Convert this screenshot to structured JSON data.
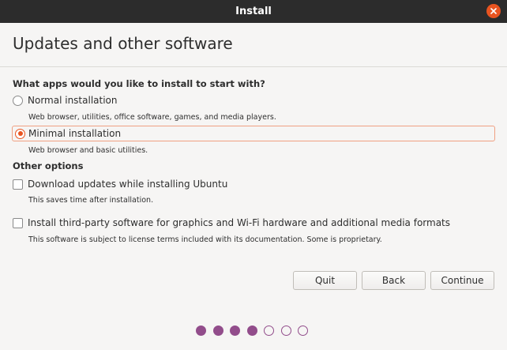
{
  "window": {
    "title": "Install"
  },
  "page": {
    "title": "Updates and other software"
  },
  "install_section": {
    "heading": "What apps would you like to install to start with?",
    "options": [
      {
        "label": "Normal installation",
        "description": "Web browser, utilities, office software, games, and media players.",
        "selected": false
      },
      {
        "label": "Minimal installation",
        "description": "Web browser and basic utilities.",
        "selected": true
      }
    ]
  },
  "other_section": {
    "heading": "Other options",
    "options": [
      {
        "label": "Download updates while installing Ubuntu",
        "description": "This saves time after installation.",
        "checked": false
      },
      {
        "label": "Install third-party software for graphics and Wi-Fi hardware and additional media formats",
        "description": "This software is subject to license terms included with its documentation. Some is proprietary.",
        "checked": false
      }
    ]
  },
  "buttons": {
    "quit": "Quit",
    "back": "Back",
    "continue": "Continue"
  },
  "progress": {
    "total_steps": 7,
    "completed_steps": 4
  },
  "colors": {
    "accent": "#e95420",
    "progress": "#924d8b",
    "titlebar": "#2c2c2c"
  }
}
